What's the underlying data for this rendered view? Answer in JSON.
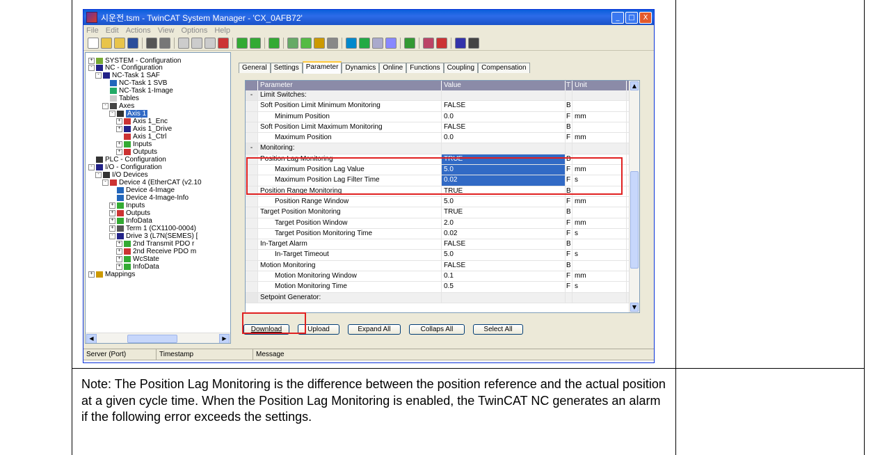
{
  "window": {
    "title": "시운전.tsm - TwinCAT System Manager - 'CX_0AFB72'",
    "buttons": {
      "minimize": "_",
      "maximize": "□",
      "close": "X"
    }
  },
  "menu": [
    "File",
    "Edit",
    "Actions",
    "View",
    "Options",
    "Help"
  ],
  "tree": [
    {
      "label": "SYSTEM - Configuration",
      "expander": "+"
    },
    {
      "label": "NC - Configuration",
      "expander": "-"
    },
    {
      "label": "NC-Task 1 SAF",
      "expander": "-"
    },
    {
      "label": "NC-Task 1 SVB"
    },
    {
      "label": "NC-Task 1-Image"
    },
    {
      "label": "Tables"
    },
    {
      "label": "Axes",
      "expander": "-"
    },
    {
      "label": "Axis 1",
      "expander": "-",
      "selected": true
    },
    {
      "label": "Axis 1_Enc",
      "expander": "+"
    },
    {
      "label": "Axis 1_Drive",
      "expander": "+"
    },
    {
      "label": "Axis 1_Ctrl"
    },
    {
      "label": "Inputs",
      "expander": "+"
    },
    {
      "label": "Outputs",
      "expander": "+"
    },
    {
      "label": "PLC - Configuration"
    },
    {
      "label": "I/O - Configuration",
      "expander": "-"
    },
    {
      "label": "I/O Devices",
      "expander": "-"
    },
    {
      "label": "Device 4 (EtherCAT (v2.10",
      "expander": "-"
    },
    {
      "label": "Device 4-Image"
    },
    {
      "label": "Device 4-Image-Info"
    },
    {
      "label": "Inputs",
      "expander": "+"
    },
    {
      "label": "Outputs",
      "expander": "+"
    },
    {
      "label": "InfoData",
      "expander": "+"
    },
    {
      "label": "Term 1 (CX1100-0004)",
      "expander": "+"
    },
    {
      "label": "Drive 3 (L7N(SEMES) [",
      "expander": "-"
    },
    {
      "label": "2nd Transmit PDO r",
      "expander": "+"
    },
    {
      "label": "2nd Receive PDO m",
      "expander": "+"
    },
    {
      "label": "WcState",
      "expander": "+"
    },
    {
      "label": "InfoData",
      "expander": "+"
    },
    {
      "label": "Mappings",
      "expander": "+"
    }
  ],
  "tabs": [
    "General",
    "Settings",
    "Parameter",
    "Dynamics",
    "Online",
    "Functions",
    "Coupling",
    "Compensation"
  ],
  "active_tab": "Parameter",
  "grid": {
    "headers": {
      "parameter": "Parameter",
      "value": "Value",
      "type": "T",
      "unit": "Unit"
    },
    "rows": [
      {
        "exp": "-",
        "name": "Limit Switches:",
        "value": "",
        "type": "",
        "unit": "",
        "group": true
      },
      {
        "exp": "",
        "name": "Soft Position Limit Minimum Monitoring",
        "value": "FALSE",
        "type": "B",
        "unit": ""
      },
      {
        "exp": "",
        "name": "Minimum Position",
        "value": "0.0",
        "type": "F",
        "unit": "mm",
        "indent": true
      },
      {
        "exp": "",
        "name": "Soft Position Limit Maximum Monitoring",
        "value": "FALSE",
        "type": "B",
        "unit": ""
      },
      {
        "exp": "",
        "name": "Maximum Position",
        "value": "0.0",
        "type": "F",
        "unit": "mm",
        "indent": true
      },
      {
        "exp": "-",
        "name": "Monitoring:",
        "value": "",
        "type": "",
        "unit": "",
        "group": true
      },
      {
        "exp": "",
        "name": "Position Lag Monitoring",
        "value": "TRUE",
        "type": "B",
        "unit": "",
        "highlight": true
      },
      {
        "exp": "",
        "name": "Maximum Position Lag Value",
        "value": "5.0",
        "type": "F",
        "unit": "mm",
        "indent": true,
        "highlight": true
      },
      {
        "exp": "",
        "name": "Maximum Position Lag Filter Time",
        "value": "0.02",
        "type": "F",
        "unit": "s",
        "indent": true,
        "highlight": true
      },
      {
        "exp": "",
        "name": "Position Range Monitoring",
        "value": "TRUE",
        "type": "B",
        "unit": ""
      },
      {
        "exp": "",
        "name": "Position Range Window",
        "value": "5.0",
        "type": "F",
        "unit": "mm",
        "indent": true
      },
      {
        "exp": "",
        "name": "Target Position Monitoring",
        "value": "TRUE",
        "type": "B",
        "unit": ""
      },
      {
        "exp": "",
        "name": "Target Position Window",
        "value": "2.0",
        "type": "F",
        "unit": "mm",
        "indent": true
      },
      {
        "exp": "",
        "name": "Target Position Monitoring Time",
        "value": "0.02",
        "type": "F",
        "unit": "s",
        "indent": true
      },
      {
        "exp": "",
        "name": "In-Target Alarm",
        "value": "FALSE",
        "type": "B",
        "unit": ""
      },
      {
        "exp": "",
        "name": "In-Target Timeout",
        "value": "5.0",
        "type": "F",
        "unit": "s",
        "indent": true
      },
      {
        "exp": "",
        "name": "Motion Monitoring",
        "value": "FALSE",
        "type": "B",
        "unit": ""
      },
      {
        "exp": "",
        "name": "Motion Monitoring Window",
        "value": "0.1",
        "type": "F",
        "unit": "mm",
        "indent": true
      },
      {
        "exp": "",
        "name": "Motion Monitoring Time",
        "value": "0.5",
        "type": "F",
        "unit": "s",
        "indent": true
      },
      {
        "exp": "",
        "name": "Setpoint Generator:",
        "value": "",
        "type": "",
        "unit": "",
        "group": true
      }
    ]
  },
  "buttons": {
    "download": "Download",
    "upload": "Upload",
    "expand_all": "Expand All",
    "collaps_all": "Collaps All",
    "select_all": "Select All"
  },
  "status": {
    "server": "Server (Port)",
    "timestamp": "Timestamp",
    "message": "Message"
  },
  "note": "Note: The Position Lag Monitoring is the difference between the position reference and the actual position at a given cycle time. When the Position Lag Monitoring is enabled, the TwinCAT NC generates an alarm if the following error exceeds the settings.",
  "colors": {
    "title_bar": "#0a5fdb",
    "highlight": "#316ac5",
    "annotation": "#e02020",
    "grid_header": "#8b8ba8"
  }
}
